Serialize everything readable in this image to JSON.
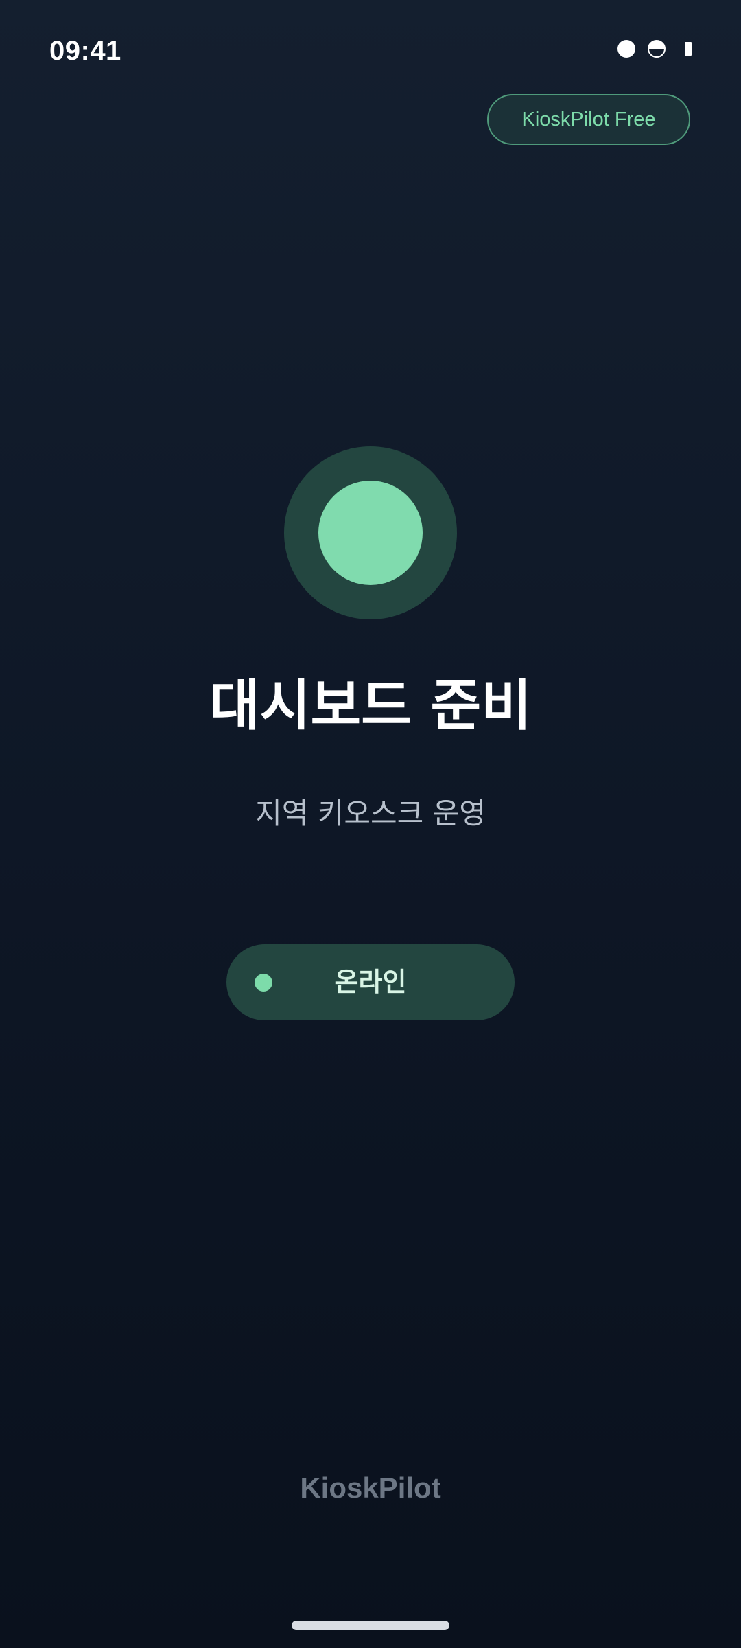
{
  "status_bar": {
    "time": "09:41",
    "icons": [
      "circle-icon",
      "half-circle-icon",
      "battery-icon"
    ]
  },
  "header": {
    "plan_badge": "KioskPilot Free"
  },
  "main": {
    "status_indicator": "status-dot-icon",
    "title": "대시보드 준비",
    "subtitle": "지역 키오스크 운영",
    "status_pill": {
      "label": "온라인"
    }
  },
  "footer": {
    "brand": "KioskPilot"
  },
  "colors": {
    "background_top": "#141f2f",
    "background_bottom": "#0a111d",
    "accent": "#80dbae",
    "accent_dark": "#234640",
    "badge_border": "#4f9a7b"
  }
}
